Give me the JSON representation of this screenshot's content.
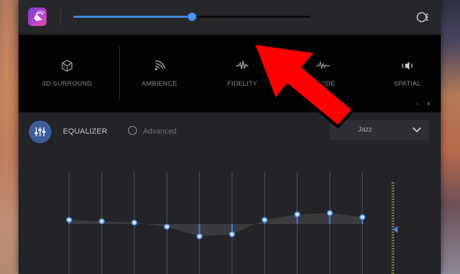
{
  "volume": {
    "level": 0.5
  },
  "effects": [
    {
      "label": "3D SURROUND",
      "icon": "3d-cube-icon"
    },
    {
      "label": "AMBIENCE",
      "icon": "ambience-waves-icon"
    },
    {
      "label": "FIDELITY",
      "icon": "fidelity-waveform-icon"
    },
    {
      "label": "ʃ MODE",
      "icon": "mode-waveform-icon"
    },
    {
      "label": "SPATIAL",
      "icon": "spatial-speaker-icon"
    }
  ],
  "equalizer": {
    "label": "EQUALIZER",
    "advanced_label": "Advanced",
    "advanced_checked": false,
    "preset": "Jazz",
    "bands_db": [
      0.6,
      0.4,
      0.2,
      -0.4,
      -1.8,
      -1.5,
      0.6,
      1.4,
      1.6,
      1.0
    ]
  },
  "colors": {
    "accent": "#3f86d8",
    "annotation_arrow": "#ff0000",
    "background": "#232428",
    "effects_strip": "#030304"
  }
}
